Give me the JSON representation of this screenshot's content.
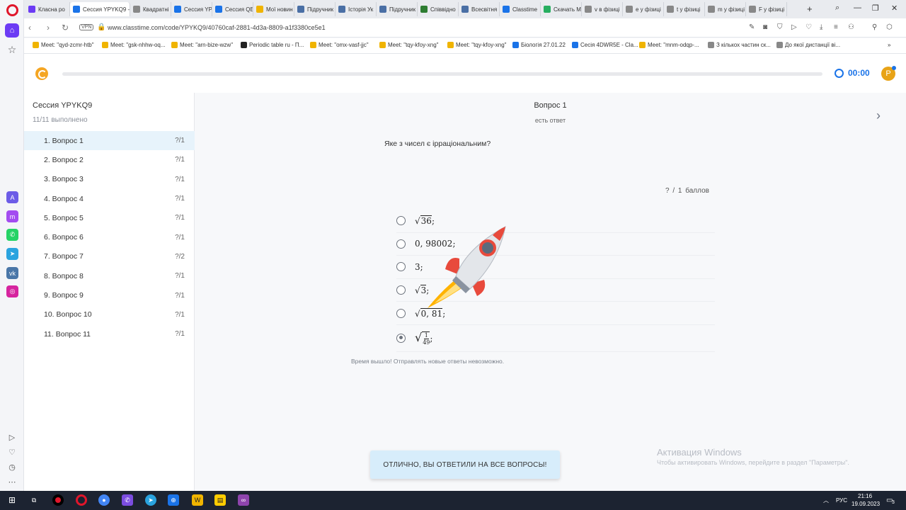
{
  "browser": {
    "tabs": [
      {
        "label": "Класна ро",
        "color": "#6c3bf4"
      },
      {
        "label": "Сессия YPYKQ9 -",
        "color": "#1a73e8"
      },
      {
        "label": "Квадратні",
        "color": "#888888"
      },
      {
        "label": "Сессия YP",
        "color": "#1a73e8"
      },
      {
        "label": "Сессия QE",
        "color": "#1a73e8"
      },
      {
        "label": "Мої новин",
        "color": "#f0b400"
      },
      {
        "label": "Підручник",
        "color": "#4a6fa5"
      },
      {
        "label": "Історія Ук",
        "color": "#4a6fa5"
      },
      {
        "label": "Підручник",
        "color": "#4a6fa5"
      },
      {
        "label": "Співвідно",
        "color": "#2e7d32"
      },
      {
        "label": "Всесвітня",
        "color": "#4a6fa5"
      },
      {
        "label": "Classtime",
        "color": "#1a73e8"
      },
      {
        "label": "Скачать М",
        "color": "#27ae60"
      },
      {
        "label": "v в фізиці",
        "color": "#888888"
      },
      {
        "label": "e у фізиці",
        "color": "#888888"
      },
      {
        "label": "t у фізиці",
        "color": "#888888"
      },
      {
        "label": "m у фізиці",
        "color": "#888888"
      },
      {
        "label": "F у фізиці",
        "color": "#888888"
      }
    ],
    "url": "www.classtime.com/code/YPYKQ9/40760caf-2881-4d3a-8809-a1f3380ce5e1",
    "vpn_label": "VPN",
    "bookmarks": [
      "Meet: \"qyd-zcmr-htb\"",
      "Meet: \"gsk-nhhw-oq...",
      "Meet: \"arn-bize-wzw\"",
      "Periodic table ru - П...",
      "Meet: \"omx-vasf-jjc\"",
      "Meet: \"tqy-kfoy-xng\"",
      "Meet: \"tqy-kfoy-xng\"",
      "Біологія 27.01.22",
      "Сесія 4DWR5E - Cla...",
      "Meet: \"mnm-odqp-...",
      "З кількох частин ск...",
      "До якої дистанції ві..."
    ]
  },
  "header": {
    "progress_percent": 0,
    "timer": "00:00",
    "avatar_letter": "P"
  },
  "sidebar": {
    "session_title": "Сессия YPYKQ9",
    "completed": "11/11 выполнено",
    "questions": [
      {
        "label": "1.  Вопрос 1",
        "score": "?/1"
      },
      {
        "label": "2.  Вопрос 2",
        "score": "?/1"
      },
      {
        "label": "3.  Вопрос 3",
        "score": "?/1"
      },
      {
        "label": "4.  Вопрос 4",
        "score": "?/1"
      },
      {
        "label": "5.  Вопрос 5",
        "score": "?/1"
      },
      {
        "label": "6.  Вопрос 6",
        "score": "?/1"
      },
      {
        "label": "7.  Вопрос 7",
        "score": "?/2"
      },
      {
        "label": "8.  Вопрос 8",
        "score": "?/1"
      },
      {
        "label": "9.  Вопрос 9",
        "score": "?/1"
      },
      {
        "label": "10.  Вопрос 10",
        "score": "?/1"
      },
      {
        "label": "11.  Вопрос 11",
        "score": "?/1"
      }
    ]
  },
  "question": {
    "title": "Вопрос 1",
    "subtitle": "есть ответ",
    "text": "Яке з чисел є ірраціональним?",
    "points": "?  /  1  баллов",
    "options": [
      {
        "radicand": "36",
        "plain": "",
        "selected": false
      },
      {
        "radicand": "",
        "plain": "0, 98002;",
        "selected": false
      },
      {
        "radicand": "",
        "plain": "3;",
        "selected": false
      },
      {
        "radicand": "3",
        "plain": "",
        "selected": false
      },
      {
        "radicand": "0, 81",
        "plain": "",
        "selected": false
      },
      {
        "radicand": "",
        "plain": "",
        "fraction": {
          "num": "1",
          "den": "49"
        },
        "selected": true
      }
    ],
    "time_up": "Время вышло! Отправлять новые ответы невозможно."
  },
  "toast": "ОТЛИЧНО, ВЫ ОТВЕТИЛИ НА ВСЕ ВОПРОСЫ!",
  "watermark": {
    "title": "Активация Windows",
    "text": "Чтобы активировать Windows, перейдите в раздел \"Параметры\"."
  },
  "taskbar": {
    "lang": "РУС",
    "time": "21:16",
    "date": "19.09.2023",
    "notif_count": "3"
  }
}
